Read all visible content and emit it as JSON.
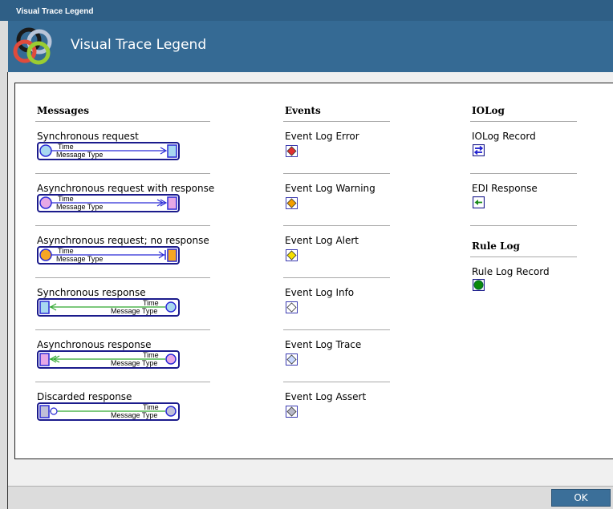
{
  "window": {
    "title": "Visual Trace Legend"
  },
  "header": {
    "title": "Visual Trace Legend"
  },
  "columns": {
    "messages": {
      "heading": "Messages",
      "items": [
        {
          "label": "Synchronous request",
          "time": "Time",
          "type": "Message Type",
          "direction": "right",
          "start_color": "#a8d8f0",
          "end_color": "#a8d8f0",
          "arrow": "single",
          "line_color": "#2b2bd6"
        },
        {
          "label": "Asynchronous request with response",
          "time": "Time",
          "type": "Message Type",
          "direction": "right",
          "start_color": "#e6a8e6",
          "end_color": "#e6a8e6",
          "arrow": "double",
          "line_color": "#2b2bd6"
        },
        {
          "label": "Asynchronous request; no response",
          "time": "Time",
          "type": "Message Type",
          "direction": "right",
          "start_color": "#f5a623",
          "end_color": "#f5a623",
          "arrow": "bar",
          "line_color": "#2b2bd6"
        },
        {
          "label": "Synchronous response",
          "time": "Time",
          "type": "Message Type",
          "direction": "left",
          "start_color": "#a8d8f0",
          "end_color": "#a8d8f0",
          "arrow": "single",
          "line_color": "#2fa82f"
        },
        {
          "label": "Asynchronous response",
          "time": "Time",
          "type": "Message Type",
          "direction": "left",
          "start_color": "#e6a8e6",
          "end_color": "#e6a8e6",
          "arrow": "double",
          "line_color": "#2fa82f"
        },
        {
          "label": "Discarded response",
          "time": "Time",
          "type": "Message Type",
          "direction": "left",
          "start_color": "#c0c0d8",
          "end_color": "#c0c0d8",
          "arrow": "none",
          "line_color": "#2fa82f"
        }
      ]
    },
    "events": {
      "heading": "Events",
      "items": [
        {
          "label": "Event Log Error",
          "icon": "diamond-red-icon",
          "color": "#e03030"
        },
        {
          "label": "Event Log Warning",
          "icon": "diamond-orange-icon",
          "color": "#f5a000"
        },
        {
          "label": "Event Log Alert",
          "icon": "diamond-yellow-icon",
          "color": "#f5e000"
        },
        {
          "label": "Event Log Info",
          "icon": "diamond-white-icon",
          "color": "#ffffff"
        },
        {
          "label": "Event Log Trace",
          "icon": "diamond-lightblue-icon",
          "color": "#c8d8ff"
        },
        {
          "label": "Event Log Assert",
          "icon": "diamond-grey-icon",
          "color": "#b8b8c8"
        }
      ]
    },
    "iolog": {
      "heading": "IOLog",
      "items": [
        {
          "label": "IOLog Record",
          "icon": "swap-arrows-icon"
        },
        {
          "label": "EDI Response",
          "icon": "left-arrow-icon"
        }
      ]
    },
    "rulelog": {
      "heading": "Rule Log",
      "items": [
        {
          "label": "Rule Log Record",
          "icon": "green-circle-icon",
          "color": "#0a8a0a"
        }
      ]
    }
  },
  "footer": {
    "ok_label": "OK"
  }
}
